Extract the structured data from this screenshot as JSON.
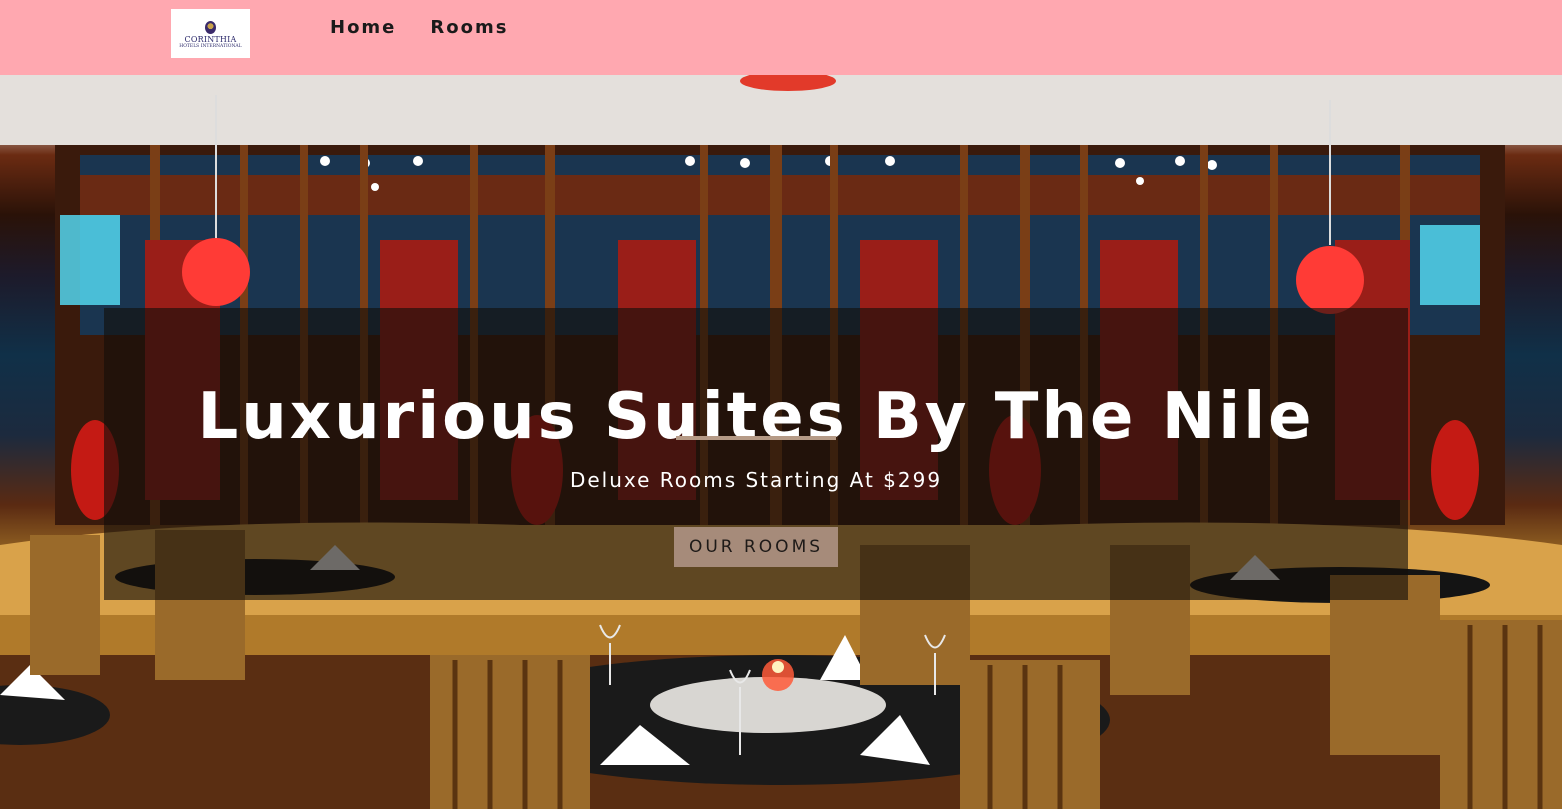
{
  "nav": {
    "logo_name": "CORINTHIA",
    "logo_sub": "HOTELS INTERNATIONAL",
    "links": [
      "Home",
      "Rooms"
    ]
  },
  "hero": {
    "headline": "Luxurious Suites By The Nile",
    "subheadline": "Deluxe Rooms Starting At $299",
    "cta_label": "OUR ROOMS"
  },
  "colors": {
    "navbar_bg": "#ffa8b0",
    "overlay": "rgba(20,14,10,0.62)",
    "divider": "#b59a86",
    "cta_bg": "#a68b7a"
  }
}
